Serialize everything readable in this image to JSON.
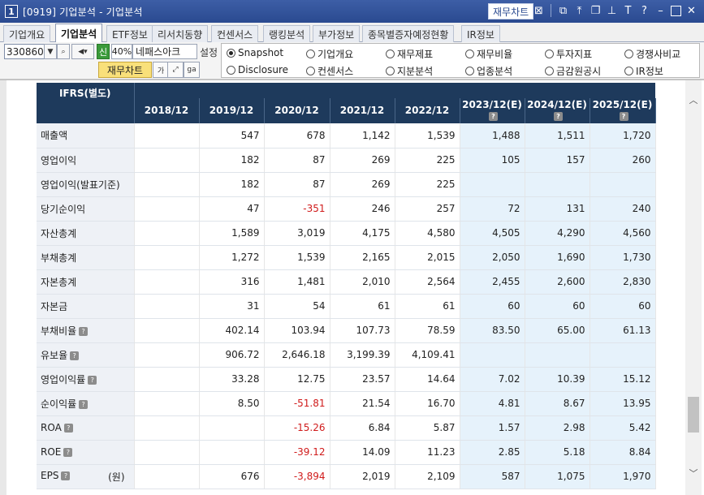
{
  "window": {
    "number": "1",
    "title": "[0919] 기업분석 - 기업분석",
    "header_button": "재무차트"
  },
  "tabs": [
    {
      "label": "기업개요",
      "active": false
    },
    {
      "label": "기업분석",
      "active": true
    },
    {
      "label": "ETF정보",
      "active": false
    },
    {
      "label": "리서치동향",
      "active": false
    },
    {
      "label": "컨센서스",
      "active": false
    },
    {
      "label": "랭킹분석",
      "active": false
    },
    {
      "label": "부가정보",
      "active": false
    },
    {
      "label": "종목별증자예정현황",
      "active": false
    },
    {
      "label": "IR정보",
      "active": false
    }
  ],
  "controls": {
    "code": "330860",
    "shin": "신",
    "pct": "40%",
    "name": "네패스아크",
    "settings": "설정",
    "chart_button": "재무차트",
    "ga": "가"
  },
  "radios": [
    {
      "label": "Snapshot",
      "checked": true
    },
    {
      "label": "기업개요",
      "checked": false
    },
    {
      "label": "재무제표",
      "checked": false
    },
    {
      "label": "재무비율",
      "checked": false
    },
    {
      "label": "투자지표",
      "checked": false
    },
    {
      "label": "경쟁사비교",
      "checked": false
    },
    {
      "label": "Disclosure",
      "checked": false
    },
    {
      "label": "컨센서스",
      "checked": false
    },
    {
      "label": "지분분석",
      "checked": false
    },
    {
      "label": "업종분석",
      "checked": false
    },
    {
      "label": "금감원공시",
      "checked": false
    },
    {
      "label": "IR정보",
      "checked": false
    }
  ],
  "table": {
    "corner": "IFRS(별도)",
    "years": [
      "2018/12",
      "2019/12",
      "2020/12",
      "2021/12",
      "2022/12",
      "2023/12(E)",
      "2024/12(E)",
      "2025/12(E)"
    ],
    "rows": [
      {
        "label": "매출액",
        "help": false,
        "unit": "",
        "values": [
          "",
          "547",
          "678",
          "1,142",
          "1,539",
          "1,488",
          "1,511",
          "1,720"
        ]
      },
      {
        "label": "영업이익",
        "help": false,
        "unit": "",
        "values": [
          "",
          "182",
          "87",
          "269",
          "225",
          "105",
          "157",
          "260"
        ]
      },
      {
        "label": "영업이익(발표기준)",
        "help": false,
        "unit": "",
        "values": [
          "",
          "182",
          "87",
          "269",
          "225",
          "",
          "",
          ""
        ]
      },
      {
        "label": "당기순이익",
        "help": false,
        "unit": "",
        "values": [
          "",
          "47",
          "-351",
          "246",
          "257",
          "72",
          "131",
          "240"
        ]
      },
      {
        "label": "자산총계",
        "help": false,
        "unit": "",
        "values": [
          "",
          "1,589",
          "3,019",
          "4,175",
          "4,580",
          "4,505",
          "4,290",
          "4,560"
        ]
      },
      {
        "label": "부채총계",
        "help": false,
        "unit": "",
        "values": [
          "",
          "1,272",
          "1,539",
          "2,165",
          "2,015",
          "2,050",
          "1,690",
          "1,730"
        ]
      },
      {
        "label": "자본총계",
        "help": false,
        "unit": "",
        "values": [
          "",
          "316",
          "1,481",
          "2,010",
          "2,564",
          "2,455",
          "2,600",
          "2,830"
        ]
      },
      {
        "label": "자본금",
        "help": false,
        "unit": "",
        "values": [
          "",
          "31",
          "54",
          "61",
          "61",
          "60",
          "60",
          "60"
        ]
      },
      {
        "label": "부채비율",
        "help": true,
        "unit": "",
        "values": [
          "",
          "402.14",
          "103.94",
          "107.73",
          "78.59",
          "83.50",
          "65.00",
          "61.13"
        ]
      },
      {
        "label": "유보율",
        "help": true,
        "unit": "",
        "values": [
          "",
          "906.72",
          "2,646.18",
          "3,199.39",
          "4,109.41",
          "",
          "",
          ""
        ]
      },
      {
        "label": "영업이익률",
        "help": true,
        "unit": "",
        "values": [
          "",
          "33.28",
          "12.75",
          "23.57",
          "14.64",
          "7.02",
          "10.39",
          "15.12"
        ]
      },
      {
        "label": "순이익률",
        "help": true,
        "unit": "",
        "values": [
          "",
          "8.50",
          "-51.81",
          "21.54",
          "16.70",
          "4.81",
          "8.67",
          "13.95"
        ]
      },
      {
        "label": "ROA",
        "help": true,
        "unit": "",
        "values": [
          "",
          "",
          "-15.26",
          "6.84",
          "5.87",
          "1.57",
          "2.98",
          "5.42"
        ]
      },
      {
        "label": "ROE",
        "help": true,
        "unit": "",
        "values": [
          "",
          "",
          "-39.12",
          "14.09",
          "11.23",
          "2.85",
          "5.18",
          "8.84"
        ]
      },
      {
        "label": "EPS",
        "help": true,
        "unit": "(원)",
        "values": [
          "",
          "676",
          "-3,894",
          "2,019",
          "2,109",
          "587",
          "1,075",
          "1,970"
        ]
      }
    ]
  },
  "colors": {
    "header_bg": "#1e3a5c",
    "estimate_bg": "#e6f2fb",
    "negative": "#d01b1b",
    "label_bg": "#eef1f6"
  }
}
